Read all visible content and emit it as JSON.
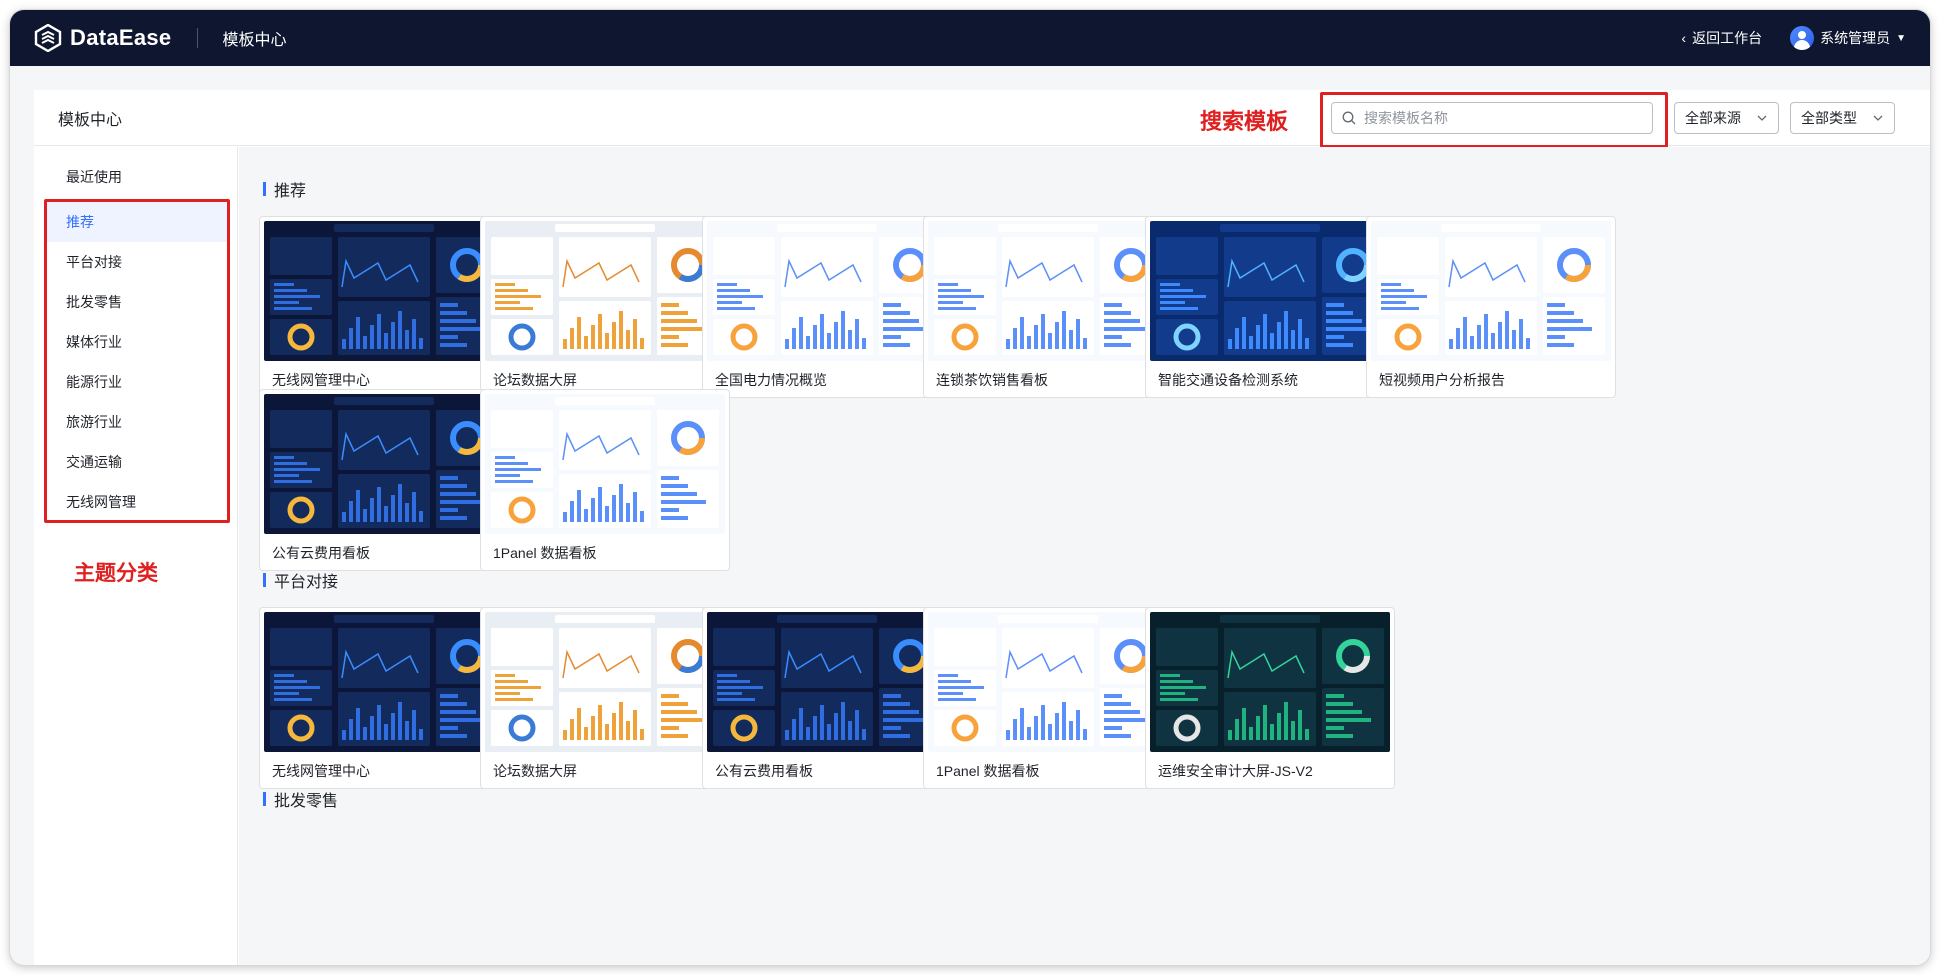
{
  "topbar": {
    "logo_text": "DataEase",
    "title": "模板中心",
    "back_label": "返回工作台",
    "user_label": "系统管理员"
  },
  "header": {
    "title": "模板中心",
    "search_annotation": "搜索模板",
    "search_placeholder": "搜索模板名称",
    "source_filter": "全部来源",
    "type_filter": "全部类型"
  },
  "sidebar": {
    "recent": "最近使用",
    "categories": [
      "推荐",
      "平台对接",
      "批发零售",
      "媒体行业",
      "能源行业",
      "旅游行业",
      "交通运输",
      "无线网管理"
    ],
    "active_index": 0,
    "theme_annotation": "主题分类"
  },
  "sections": [
    {
      "title": "推荐",
      "templates": [
        {
          "name": "无线网管理中心",
          "style": "dark"
        },
        {
          "name": "论坛数据大屏",
          "style": "light"
        },
        {
          "name": "全国电力情况概览",
          "style": "white"
        },
        {
          "name": "连锁茶饮销售看板",
          "style": "white"
        },
        {
          "name": "智能交通设备检测系统",
          "style": "navy"
        },
        {
          "name": "短视频用户分析报告",
          "style": "white"
        },
        {
          "name": "公有云费用看板",
          "style": "dark"
        },
        {
          "name": "1Panel 数据看板",
          "style": "white"
        }
      ]
    },
    {
      "title": "平台对接",
      "templates": [
        {
          "name": "无线网管理中心",
          "style": "dark"
        },
        {
          "name": "论坛数据大屏",
          "style": "light"
        },
        {
          "name": "公有云费用看板",
          "style": "dark"
        },
        {
          "name": "1Panel 数据看板",
          "style": "white"
        },
        {
          "name": "运维安全审计大屏-JS-V2",
          "style": "teal"
        }
      ]
    },
    {
      "title": "批发零售",
      "templates": []
    }
  ],
  "colors": {
    "topbar": "#0f1730",
    "accent": "#3370ff",
    "annotation": "#e02020"
  }
}
